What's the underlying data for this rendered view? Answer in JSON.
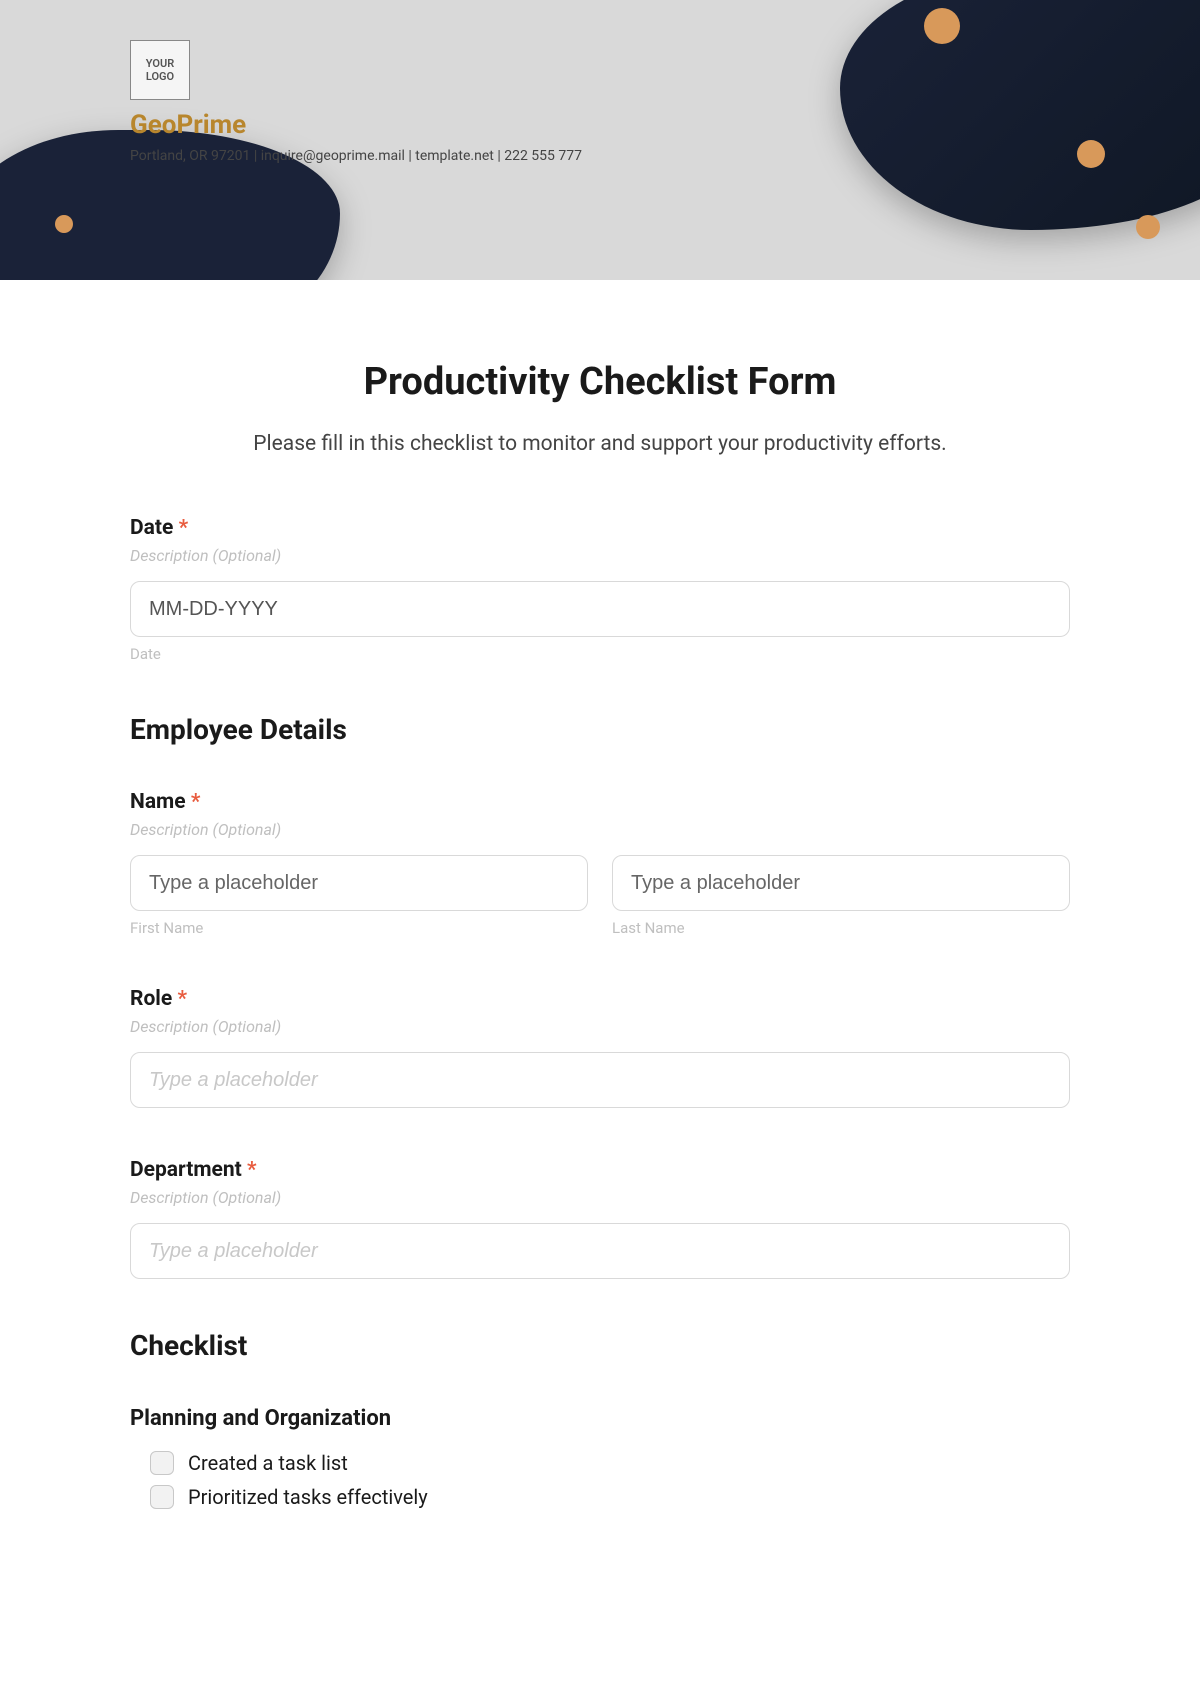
{
  "header": {
    "logo_text": "YOUR LOGO",
    "company_name": "GeoPrime",
    "company_info": "Portland, OR 97201 | inquire@geoprime.mail | template.net | 222 555 777"
  },
  "form": {
    "title": "Productivity Checklist Form",
    "subtitle": "Please fill in this checklist to monitor and support your productivity efforts."
  },
  "fields": {
    "date": {
      "label": "Date",
      "required": "*",
      "description": "Description (Optional)",
      "placeholder": "MM-DD-YYYY",
      "sublabel": "Date"
    },
    "name": {
      "label": "Name",
      "required": "*",
      "description": "Description (Optional)",
      "first_placeholder": "Type a placeholder",
      "last_placeholder": "Type a placeholder",
      "first_sublabel": "First Name",
      "last_sublabel": "Last Name"
    },
    "role": {
      "label": "Role",
      "required": "*",
      "description": "Description (Optional)",
      "placeholder": "Type a placeholder"
    },
    "department": {
      "label": "Department",
      "required": "*",
      "description": "Description (Optional)",
      "placeholder": "Type a placeholder"
    }
  },
  "sections": {
    "employee_details": "Employee Details",
    "checklist": "Checklist",
    "planning": "Planning and Organization"
  },
  "checklist_items": {
    "item1": "Created a task list",
    "item2": "Prioritized tasks effectively"
  }
}
